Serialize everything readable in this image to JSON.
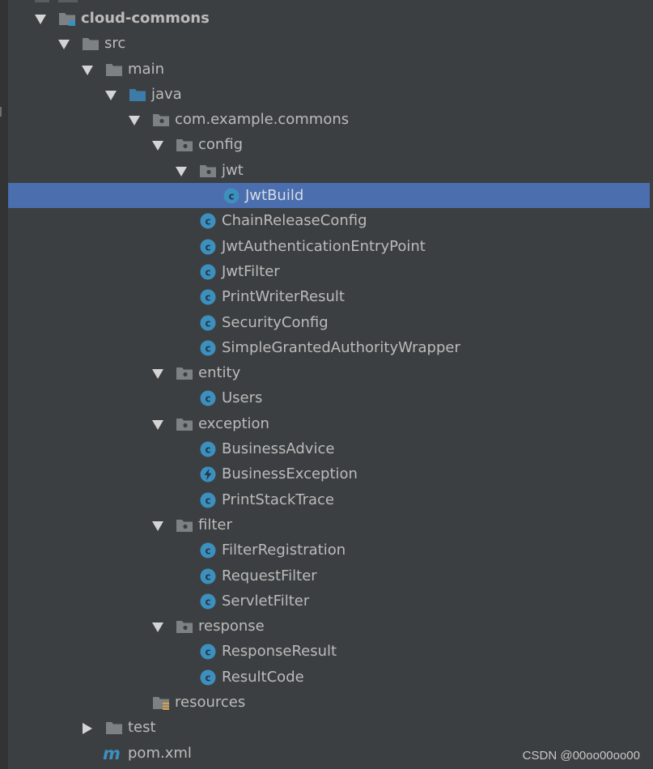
{
  "colors": {
    "background": "#3c3f41",
    "selection": "#4b6eaf",
    "text": "#bbbbbb",
    "folder": "#7d8184",
    "source_folder": "#3d7ca8",
    "class_icon": "#3d8fbe"
  },
  "project_tree": {
    "nodes": [
      {
        "label": "cloud-commons",
        "icon": "module-folder-icon",
        "arrow": "expanded",
        "depth": 0,
        "bold": true,
        "name": "tree-node-cloud-commons"
      },
      {
        "label": "src",
        "icon": "folder-icon",
        "arrow": "expanded",
        "depth": 1,
        "name": "tree-node-src"
      },
      {
        "label": "main",
        "icon": "folder-icon",
        "arrow": "expanded",
        "depth": 2,
        "name": "tree-node-main"
      },
      {
        "label": "java",
        "icon": "source-folder-icon",
        "arrow": "expanded",
        "depth": 3,
        "name": "tree-node-java"
      },
      {
        "label": "com.example.commons",
        "icon": "package-icon",
        "arrow": "expanded",
        "depth": 4,
        "name": "tree-node-com-example-commons"
      },
      {
        "label": "config",
        "icon": "package-icon",
        "arrow": "expanded",
        "depth": 5,
        "name": "tree-node-config"
      },
      {
        "label": "jwt",
        "icon": "package-icon",
        "arrow": "expanded",
        "depth": 6,
        "name": "tree-node-jwt"
      },
      {
        "label": "JwtBuild",
        "icon": "class-icon",
        "arrow": "none",
        "depth": 7,
        "selected": true,
        "name": "tree-node-jwtbuild"
      },
      {
        "label": "ChainReleaseConfig",
        "icon": "class-icon",
        "arrow": "none",
        "depth": 6,
        "name": "tree-node-chainreleaseconfig"
      },
      {
        "label": "JwtAuthenticationEntryPoint",
        "icon": "class-icon",
        "arrow": "none",
        "depth": 6,
        "name": "tree-node-jwtauthenticationentrypoint"
      },
      {
        "label": "JwtFilter",
        "icon": "class-icon",
        "arrow": "none",
        "depth": 6,
        "name": "tree-node-jwtfilter"
      },
      {
        "label": "PrintWriterResult",
        "icon": "class-icon",
        "arrow": "none",
        "depth": 6,
        "name": "tree-node-printwriterresult"
      },
      {
        "label": "SecurityConfig",
        "icon": "class-icon",
        "arrow": "none",
        "depth": 6,
        "name": "tree-node-securityconfig"
      },
      {
        "label": "SimpleGrantedAuthorityWrapper",
        "icon": "class-icon",
        "arrow": "none",
        "depth": 6,
        "name": "tree-node-simplegrantedauthoritywrapper"
      },
      {
        "label": "entity",
        "icon": "package-icon",
        "arrow": "expanded",
        "depth": 5,
        "name": "tree-node-entity"
      },
      {
        "label": "Users",
        "icon": "class-icon",
        "arrow": "none",
        "depth": 6,
        "name": "tree-node-users"
      },
      {
        "label": "exception",
        "icon": "package-icon",
        "arrow": "expanded",
        "depth": 5,
        "name": "tree-node-exception"
      },
      {
        "label": "BusinessAdvice",
        "icon": "class-icon",
        "arrow": "none",
        "depth": 6,
        "name": "tree-node-businessadvice"
      },
      {
        "label": "BusinessException",
        "icon": "exception-class-icon",
        "arrow": "none",
        "depth": 6,
        "name": "tree-node-businessexception"
      },
      {
        "label": "PrintStackTrace",
        "icon": "class-icon",
        "arrow": "none",
        "depth": 6,
        "name": "tree-node-printstacktrace"
      },
      {
        "label": "filter",
        "icon": "package-icon",
        "arrow": "expanded",
        "depth": 5,
        "name": "tree-node-filter"
      },
      {
        "label": "FilterRegistration",
        "icon": "class-icon",
        "arrow": "none",
        "depth": 6,
        "name": "tree-node-filterregistration"
      },
      {
        "label": "RequestFilter",
        "icon": "class-icon",
        "arrow": "none",
        "depth": 6,
        "name": "tree-node-requestfilter"
      },
      {
        "label": "ServletFilter",
        "icon": "class-icon",
        "arrow": "none",
        "depth": 6,
        "name": "tree-node-servletfilter"
      },
      {
        "label": "response",
        "icon": "package-icon",
        "arrow": "expanded",
        "depth": 5,
        "name": "tree-node-response"
      },
      {
        "label": "ResponseResult",
        "icon": "class-icon",
        "arrow": "none",
        "depth": 6,
        "name": "tree-node-responseresult"
      },
      {
        "label": "ResultCode",
        "icon": "class-icon",
        "arrow": "none",
        "depth": 6,
        "name": "tree-node-resultcode"
      },
      {
        "label": "resources",
        "icon": "resources-folder-icon",
        "arrow": "none",
        "depth": 4,
        "name": "tree-node-resources"
      },
      {
        "label": "test",
        "icon": "folder-icon",
        "arrow": "collapsed",
        "depth": 2,
        "name": "tree-node-test"
      },
      {
        "label": "pom.xml",
        "icon": "maven-icon",
        "arrow": "none",
        "depth": 2,
        "name": "tree-node-pom-xml"
      }
    ]
  },
  "watermark": "CSDN @00oo00oo00"
}
